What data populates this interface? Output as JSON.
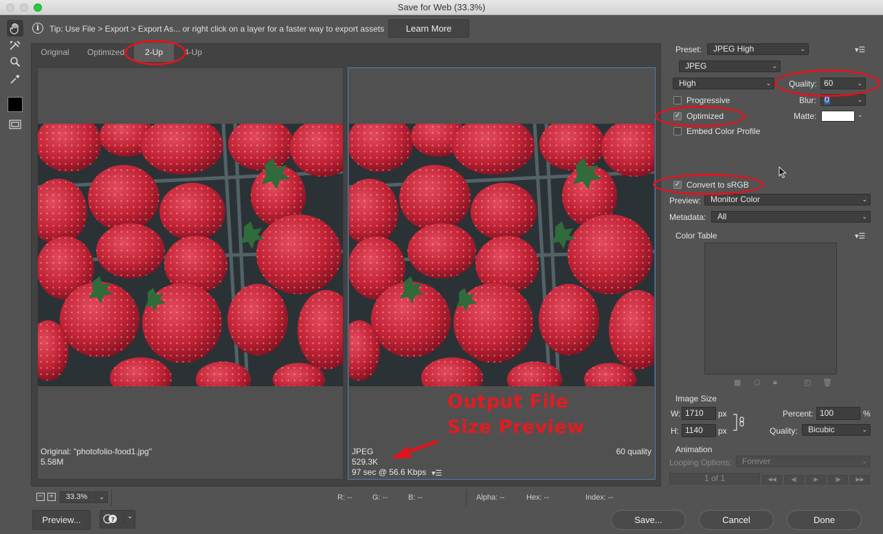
{
  "window": {
    "title": "Save for Web (33.3%)"
  },
  "tip": {
    "text": "Tip: Use File > Export > Export As...  or right click on a layer for a faster way to export assets",
    "learn_more": "Learn More"
  },
  "tabs": [
    {
      "label": "Original",
      "active": false
    },
    {
      "label": "Optimized",
      "active": false
    },
    {
      "label": "2-Up",
      "active": true
    },
    {
      "label": "4-Up",
      "active": false
    }
  ],
  "left_pane": {
    "name": "Original: \"photofolio-food1.jpg\"",
    "size": "5.58M"
  },
  "right_pane": {
    "format": "JPEG",
    "size": "529.3K",
    "time": "97 sec @ 56.6 Kbps",
    "quality_label": "60 quality"
  },
  "status": {
    "zoom": "33.3%",
    "r": "R: --",
    "g": "G: --",
    "b": "B: --",
    "alpha": "Alpha: --",
    "hex": "Hex: --",
    "index": "Index: --"
  },
  "buttons": {
    "preview": "Preview...",
    "save": "Save...",
    "cancel": "Cancel",
    "done": "Done"
  },
  "settings": {
    "preset_label": "Preset:",
    "preset": "JPEG High",
    "format": "JPEG",
    "quality_level": "High",
    "quality_label": "Quality:",
    "quality": "60",
    "progressive": {
      "label": "Progressive",
      "checked": false
    },
    "blur_label": "Blur:",
    "blur": "0",
    "optimized": {
      "label": "Optimized",
      "checked": true
    },
    "matte_label": "Matte:",
    "embed_profile": {
      "label": "Embed Color Profile",
      "checked": false
    },
    "convert_srgb": {
      "label": "Convert to sRGB",
      "checked": true
    },
    "preview_label": "Preview:",
    "preview": "Monitor Color",
    "metadata_label": "Metadata:",
    "metadata": "All",
    "color_table": "Color Table"
  },
  "image_size": {
    "header": "Image Size",
    "w_label": "W:",
    "w": "1710",
    "h_label": "H:",
    "h": "1140",
    "unit": "px",
    "percent_label": "Percent:",
    "percent": "100",
    "percent_unit": "%",
    "quality_label": "Quality:",
    "quality": "Bicubic"
  },
  "animation": {
    "header": "Animation",
    "looping_label": "Looping Options:",
    "looping": "Forever",
    "frame": "1 of 1"
  },
  "annotation": {
    "line1": "Output File",
    "line2": "Size Preview"
  },
  "colors": {
    "accent_ring": "#e0141d",
    "pane_selected": "#4f7fb8"
  }
}
